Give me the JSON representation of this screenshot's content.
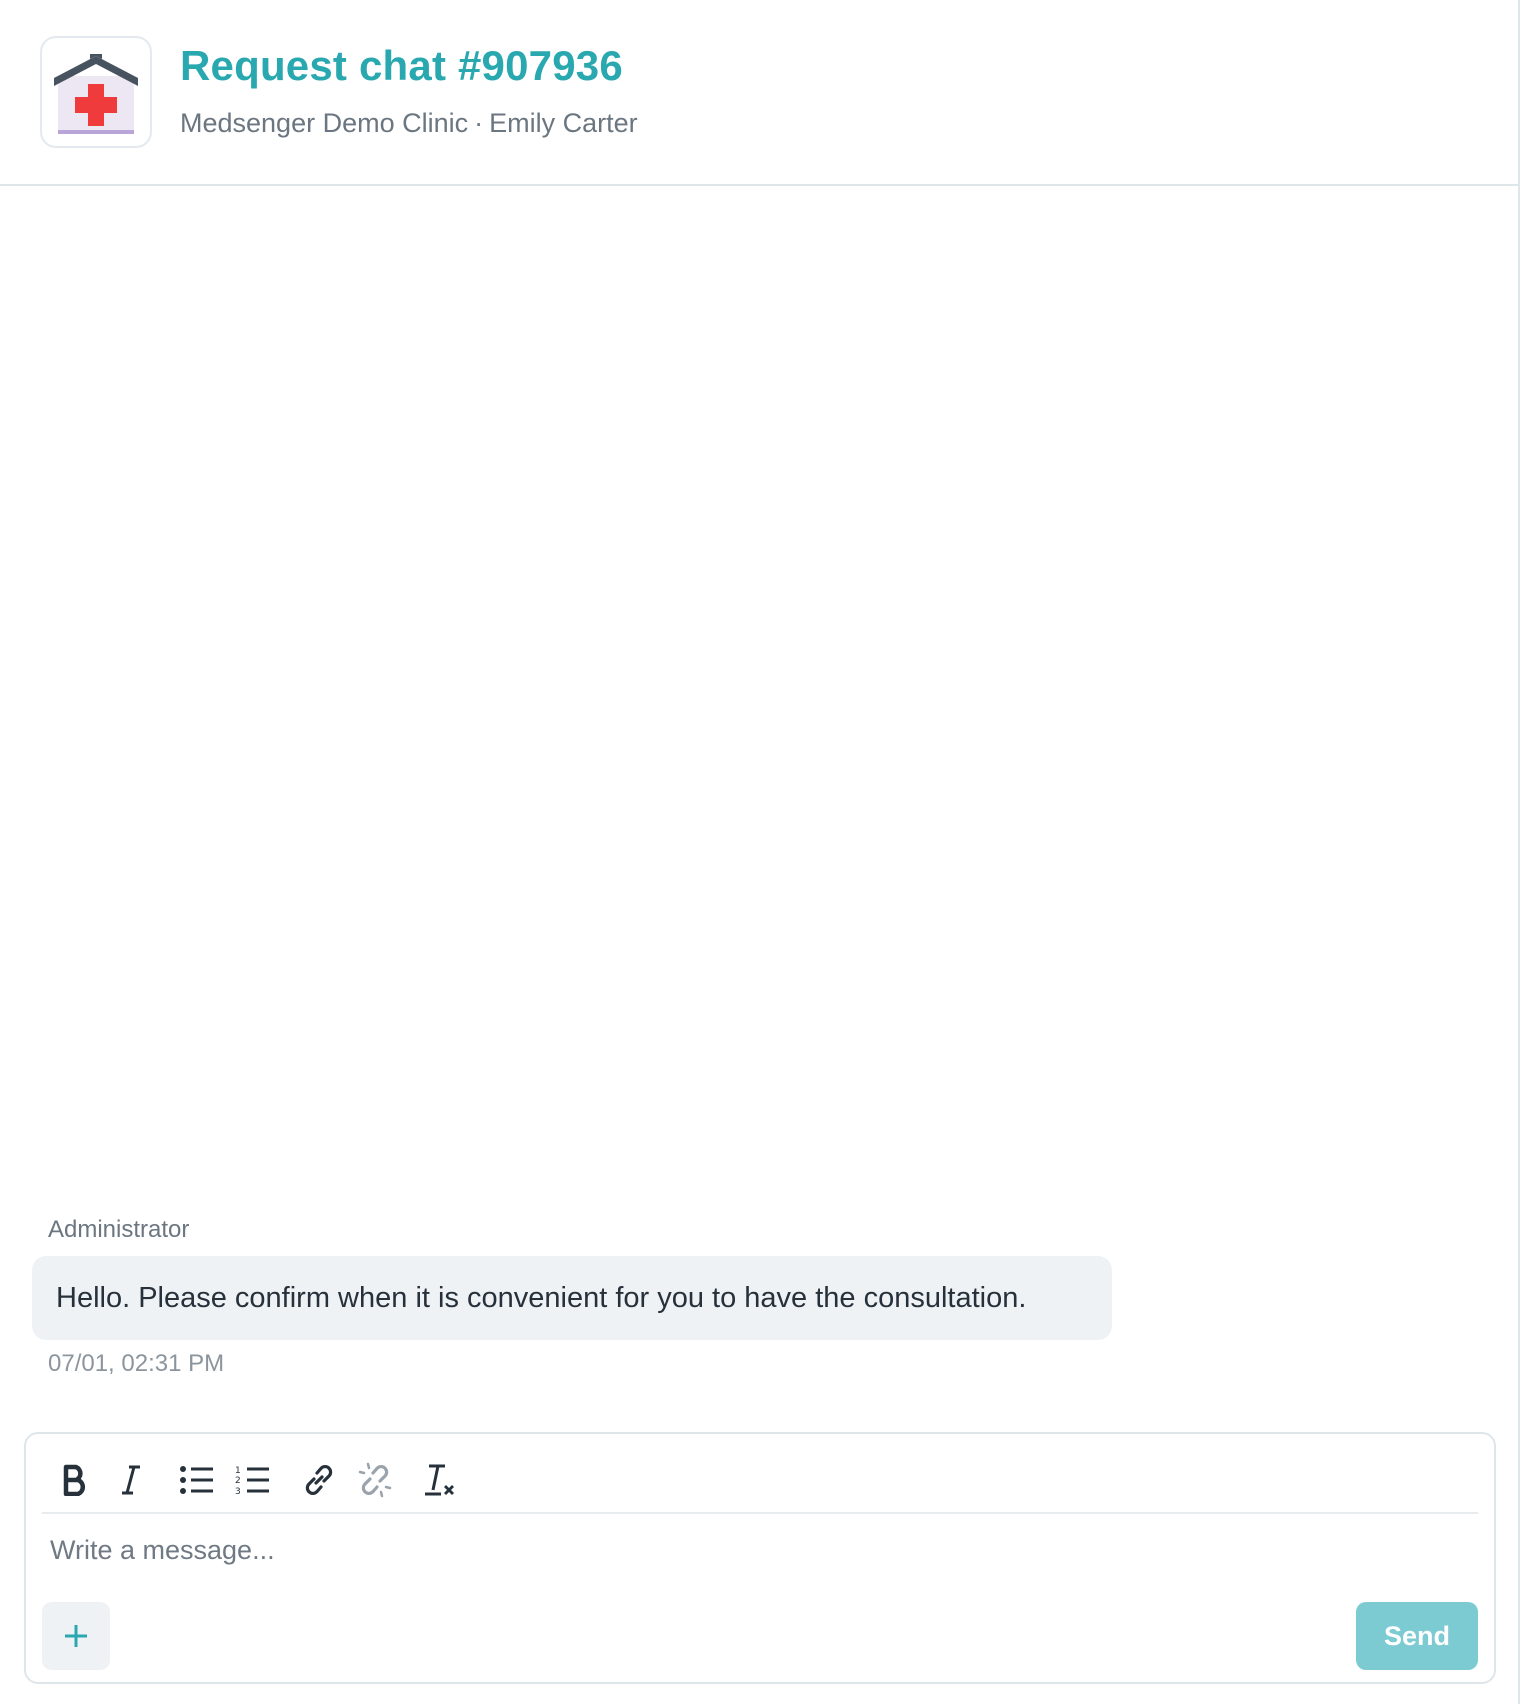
{
  "header": {
    "title": "Request chat #907936",
    "clinic": "Medsenger Demo Clinic",
    "separator": "·",
    "patient": "Emily Carter",
    "logo_icon": "hospital-icon"
  },
  "messages": [
    {
      "sender": "Administrator",
      "text": "Hello. Please confirm when it is convenient for you to have the consultation.",
      "time": "07/01, 02:31 PM"
    }
  ],
  "composer": {
    "placeholder": "Write a message...",
    "send_label": "Send",
    "toolbar": [
      "bold-icon",
      "italic-icon",
      "bullet-list-icon",
      "numbered-list-icon",
      "link-icon",
      "unlink-icon",
      "clear-format-icon"
    ],
    "add_icon": "plus-icon"
  },
  "colors": {
    "accent": "#2aa8b0",
    "send_button": "#7ccbd2",
    "bubble": "#eff2f5",
    "border": "#dfe6ea"
  }
}
